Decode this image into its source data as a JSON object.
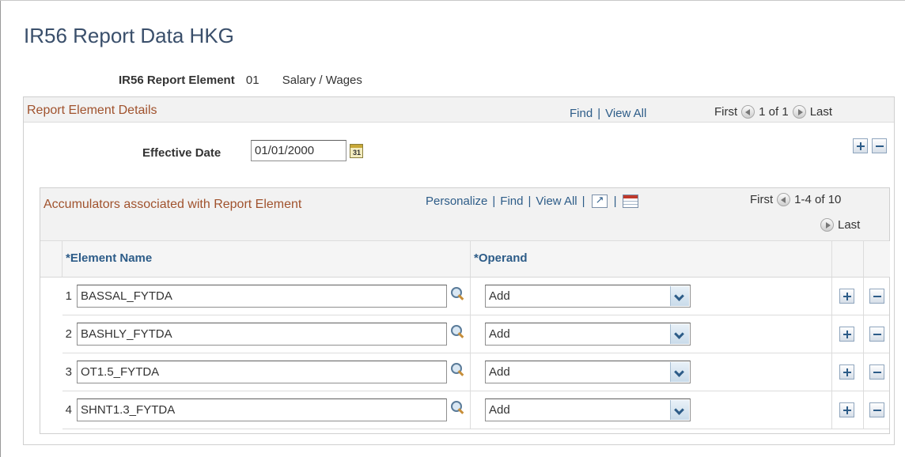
{
  "page": {
    "title": "IR56 Report Data HKG"
  },
  "report_element": {
    "label": "IR56 Report Element",
    "code": "01",
    "description": "Salary / Wages"
  },
  "details": {
    "title": "Report Element Details",
    "nav": {
      "find": "Find",
      "view_all": "View All",
      "first": "First",
      "range": "1 of 1",
      "last": "Last"
    },
    "effective_date_label": "Effective Date",
    "effective_date_value": "01/01/2000",
    "calendar_icon_text": "31"
  },
  "accumulators": {
    "title": "Accumulators associated with Report Element",
    "nav": {
      "personalize": "Personalize",
      "find": "Find",
      "view_all": "View All",
      "first": "First",
      "range": "1-4 of 10",
      "last": "Last"
    },
    "columns": {
      "element_name": "*Element Name",
      "operand": "*Operand"
    },
    "rows": [
      {
        "num": "1",
        "element_name": "BASSAL_FYTDA",
        "operand": "Add"
      },
      {
        "num": "2",
        "element_name": "BASHLY_FYTDA",
        "operand": "Add"
      },
      {
        "num": "3",
        "element_name": "OT1.5_FYTDA",
        "operand": "Add"
      },
      {
        "num": "4",
        "element_name": "SHNT1.3_FYTDA",
        "operand": "Add"
      }
    ]
  },
  "colors": {
    "title": "#3a4f6b",
    "section_title": "#a0522d",
    "link": "#2d5c88"
  }
}
